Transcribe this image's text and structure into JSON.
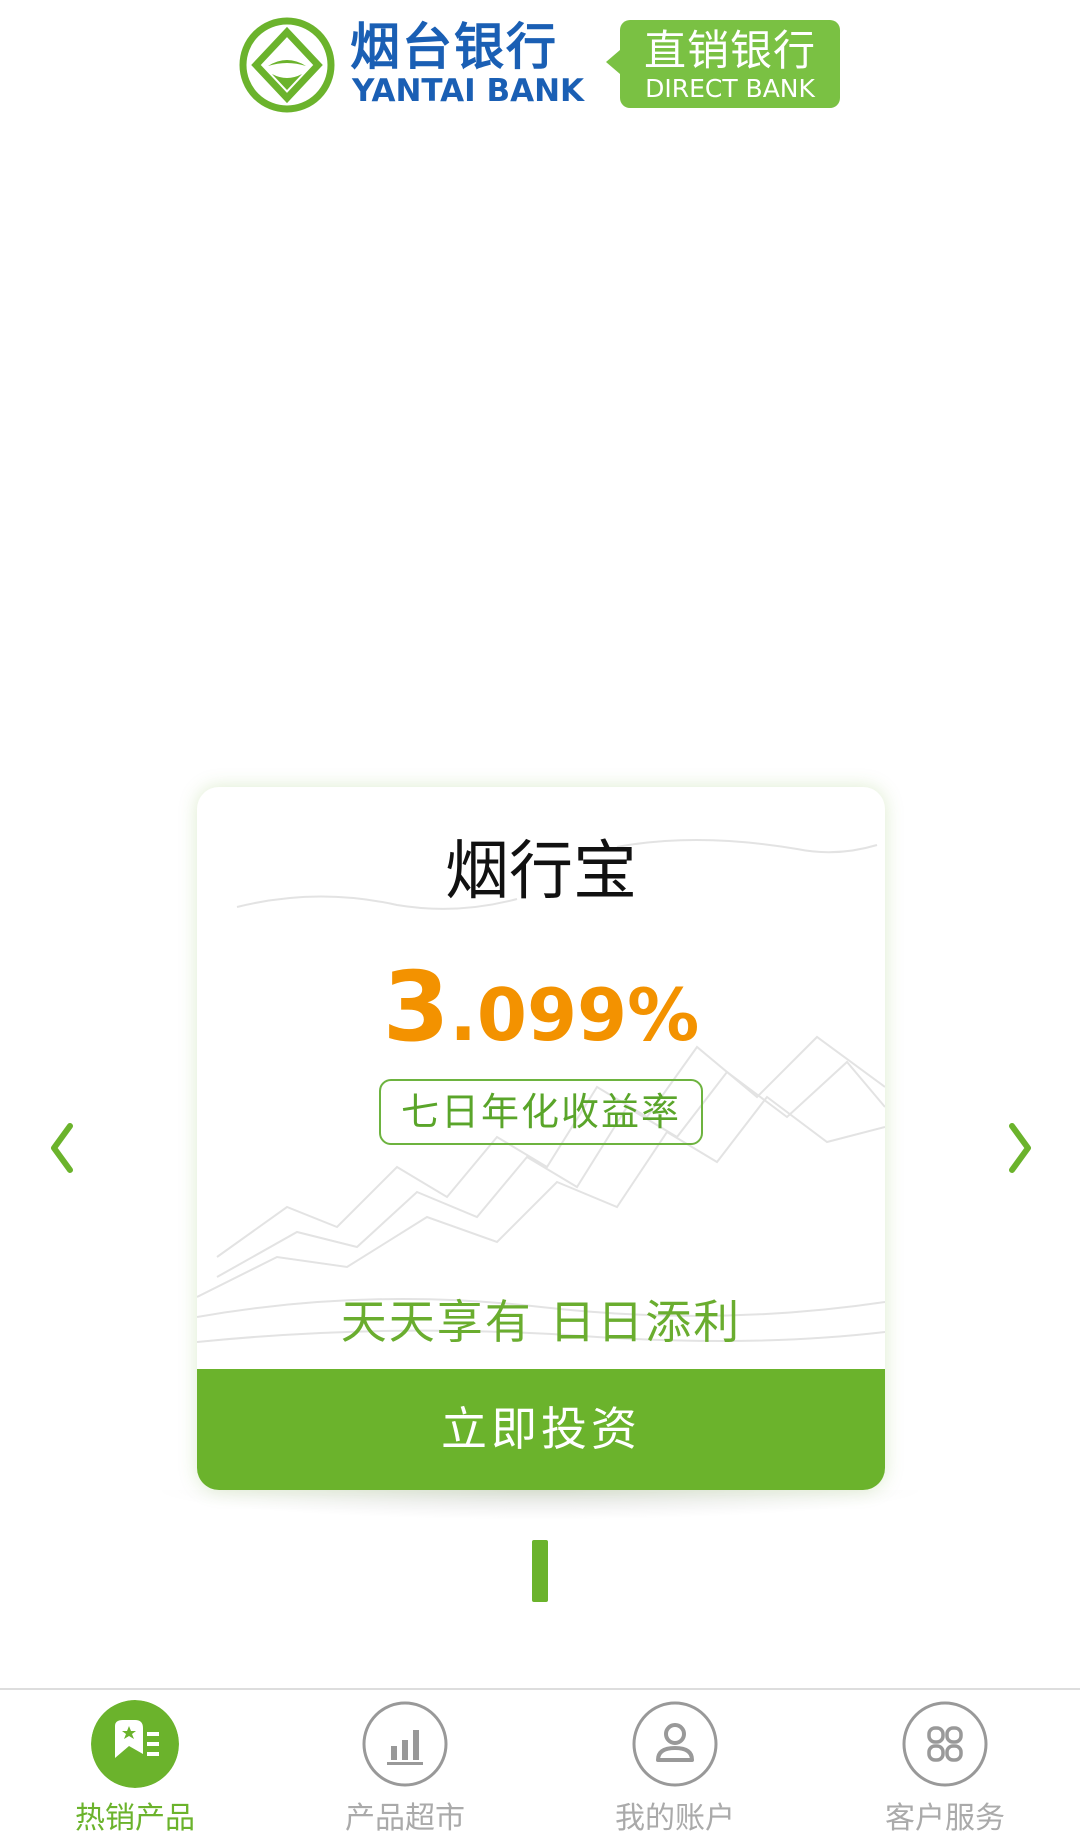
{
  "header": {
    "bank_name_cn": "烟台银行",
    "bank_name_en": "YANTAI BANK",
    "badge_cn": "直销银行",
    "badge_en": "DIRECT BANK"
  },
  "colors": {
    "brand_green": "#6bb32c",
    "brand_blue": "#1a5fb4",
    "rate_orange": "#f39200",
    "inactive_gray": "#aaaaaa"
  },
  "product_card": {
    "name": "烟行宝",
    "rate_integer": "3",
    "rate_decimal": ".099%",
    "rate_label": "七日年化收益率",
    "slogan": "天天享有 日日添利",
    "button_label": "立即投资"
  },
  "carousel": {
    "prev_icon": "chevron-left-icon",
    "next_icon": "chevron-right-icon"
  },
  "tabbar": {
    "tabs": [
      {
        "label": "热销产品",
        "icon": "hot-products-icon",
        "active": true
      },
      {
        "label": "产品超市",
        "icon": "bar-chart-icon",
        "active": false
      },
      {
        "label": "我的账户",
        "icon": "user-icon",
        "active": false
      },
      {
        "label": "客户服务",
        "icon": "service-grid-icon",
        "active": false
      }
    ]
  }
}
